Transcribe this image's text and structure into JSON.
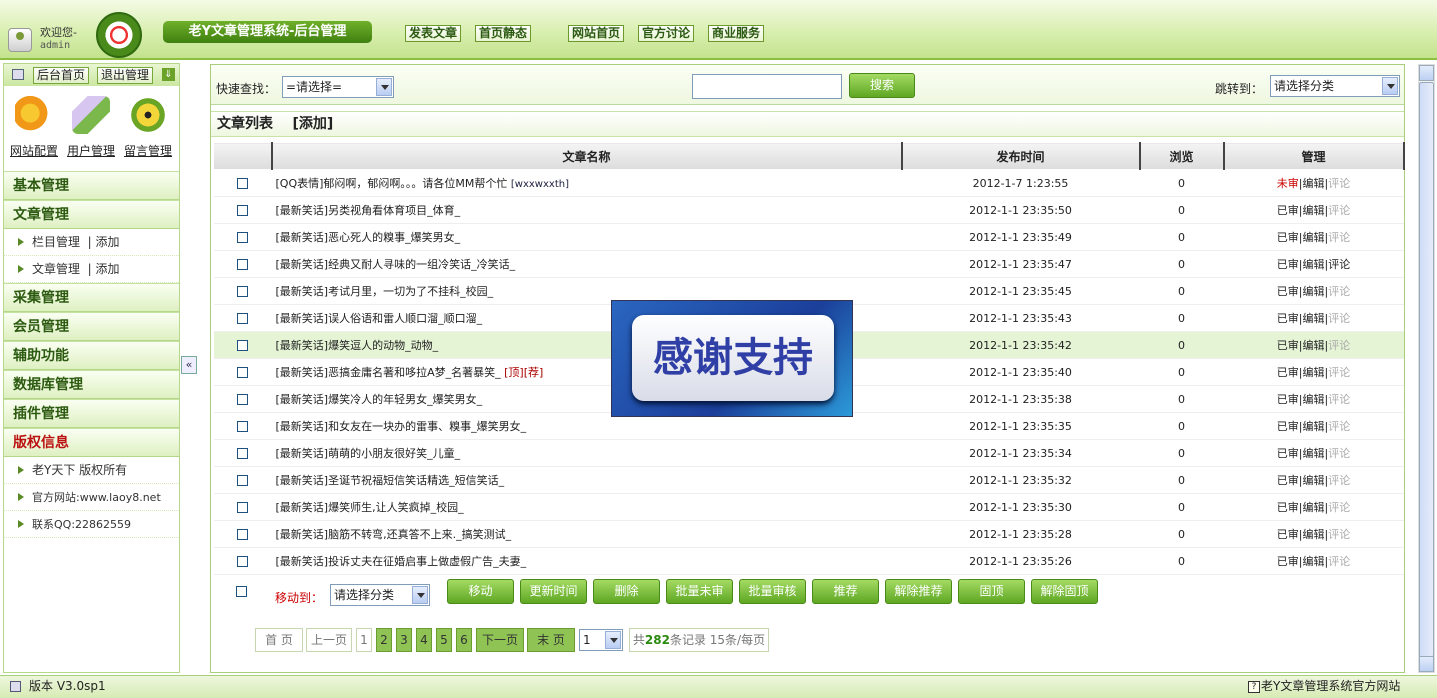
{
  "header": {
    "welcome": "欢迎您-",
    "user": "admin",
    "system_name": "老Y文章管理系统-后台管理",
    "nav": [
      "发表文章",
      "首页静态",
      "网站首页",
      "官方讨论",
      "商业服务"
    ]
  },
  "sidebar": {
    "home_btn": "后台首页",
    "logout_btn": "退出管理",
    "quick": [
      "网站配置",
      "用户管理",
      "留言管理"
    ],
    "menu": {
      "basic": "基本管理",
      "article": "文章管理",
      "column_mgr": "栏目管理",
      "article_mgr": "文章管理",
      "add": "| 添加",
      "collect": "采集管理",
      "member": "会员管理",
      "aux": "辅助功能",
      "db": "数据库管理",
      "plugin": "插件管理",
      "copyright": "版权信息",
      "c1": "老Y天下 版权所有",
      "c2": "官方网站:www.laoy8.net",
      "c3": "联系QQ:22862559"
    }
  },
  "search": {
    "label": "快速查找：",
    "select": "=请选择=",
    "button": "搜索",
    "jump_label": "跳转到：",
    "jump_select": "请选择分类"
  },
  "list": {
    "title": "文章列表",
    "add": "[添加]",
    "headers": [
      "文章名称",
      "发布时间",
      "浏览",
      "管理"
    ],
    "edit": "编辑",
    "comment": "评论",
    "rows": [
      {
        "title": "[QQ表情]郁闷啊，郁闷啊。。。请各位MM帮个忙",
        "author": "[wxxwxxth]",
        "time": "2012-1-7 1:23:55",
        "views": "0",
        "audit": "未审",
        "comment_active": false
      },
      {
        "title": "[最新笑话]另类视角看体育项目_体育_",
        "time": "2012-1-1 23:35:50",
        "views": "0",
        "audit": "已审",
        "comment_active": false
      },
      {
        "title": "[最新笑话]恶心死人的糗事_爆笑男女_",
        "time": "2012-1-1 23:35:49",
        "views": "0",
        "audit": "已审",
        "comment_active": false
      },
      {
        "title": "[最新笑话]经典又耐人寻味的一组冷笑话_冷笑话_",
        "time": "2012-1-1 23:35:47",
        "views": "0",
        "audit": "已审",
        "comment_active": true
      },
      {
        "title": "[最新笑话]考试月里，一切为了不挂科_校园_",
        "time": "2012-1-1 23:35:45",
        "views": "0",
        "audit": "已审",
        "comment_active": false
      },
      {
        "title": "[最新笑话]误人俗语和雷人顺口溜_顺口溜_",
        "time": "2012-1-1 23:35:43",
        "views": "0",
        "audit": "已审",
        "comment_active": false
      },
      {
        "title": "[最新笑话]爆笑逗人的动物_动物_",
        "time": "2012-1-1 23:35:42",
        "views": "0",
        "audit": "已审",
        "comment_active": false,
        "highlight": true
      },
      {
        "title": "[最新笑话]恶搞金庸名著和哆拉A梦_名著暴笑_",
        "tags": "[顶][荐]",
        "time": "2012-1-1 23:35:40",
        "views": "0",
        "audit": "已审",
        "comment_active": false
      },
      {
        "title": "[最新笑话]爆笑冷人的年轻男女_爆笑男女_",
        "time": "2012-1-1 23:35:38",
        "views": "0",
        "audit": "已审",
        "comment_active": false
      },
      {
        "title": "[最新笑话]和女友在一块办的雷事、糗事_爆笑男女_",
        "time": "2012-1-1 23:35:35",
        "views": "0",
        "audit": "已审",
        "comment_active": false
      },
      {
        "title": "[最新笑话]萌萌的小朋友很好笑_儿童_",
        "time": "2012-1-1 23:35:34",
        "views": "0",
        "audit": "已审",
        "comment_active": false
      },
      {
        "title": "[最新笑话]圣诞节祝福短信笑话精选_短信笑话_",
        "time": "2012-1-1 23:35:32",
        "views": "0",
        "audit": "已审",
        "comment_active": false
      },
      {
        "title": "[最新笑话]爆笑师生,让人笑疯掉_校园_",
        "time": "2012-1-1 23:35:30",
        "views": "0",
        "audit": "已审",
        "comment_active": false
      },
      {
        "title": "[最新笑话]脑筋不转弯,还真答不上来._搞笑测试_",
        "time": "2012-1-1 23:35:28",
        "views": "0",
        "audit": "已审",
        "comment_active": false
      },
      {
        "title": "[最新笑话]投诉丈夫在征婚启事上做虚假广告_夫妻_",
        "time": "2012-1-1 23:35:26",
        "views": "0",
        "audit": "已审",
        "comment_active": false
      }
    ]
  },
  "batch": {
    "move_label": "移动到：",
    "move_select": "请选择分类",
    "buttons": [
      "移动",
      "更新时间",
      "删除",
      "批量未审",
      "批量审核",
      "推荐",
      "解除推荐",
      "固顶",
      "解除固顶"
    ]
  },
  "pager": {
    "first": "首 页",
    "prev": "上一页",
    "pages": [
      "1",
      "2",
      "3",
      "4",
      "5",
      "6"
    ],
    "current_page": "1",
    "next": "下一页",
    "last": "末 页",
    "select": "1",
    "total_prefix": "共",
    "total": "282",
    "total_suffix": "条记录 15条/每页"
  },
  "overlay": {
    "text": "感谢支持"
  },
  "status": {
    "version": "版本 V3.0sp1",
    "link": "老Y文章管理系统官方网站"
  },
  "colors": {
    "accent_green": "#5ea723",
    "header_green": "#3f8010",
    "audit_pending": "#c00"
  }
}
